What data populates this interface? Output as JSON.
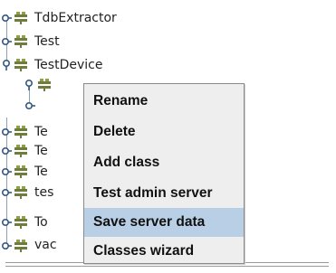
{
  "tree": {
    "nodes": [
      {
        "label": "TdbExtractor"
      },
      {
        "label": "Test"
      },
      {
        "label": "TestDevice"
      },
      {
        "label": ""
      },
      {
        "label": ""
      },
      {
        "label": "Te"
      },
      {
        "label": "Te"
      },
      {
        "label": "Te"
      },
      {
        "label": "tes"
      },
      {
        "label": "To"
      },
      {
        "label": "vac"
      }
    ]
  },
  "context_menu": {
    "items": [
      {
        "label": "Rename"
      },
      {
        "label": "Delete"
      },
      {
        "label": "Add class"
      },
      {
        "label": "Test admin server"
      },
      {
        "label": "Save server data",
        "highlighted": true
      },
      {
        "label": "Classes wizard"
      }
    ]
  },
  "icons": {
    "handle": "tree-handle-icon",
    "server": "server-icon"
  },
  "colors": {
    "menu_bg": "#eeeeee",
    "menu_highlight": "#b8cfe5",
    "tree_line": "#8aa0b6"
  }
}
